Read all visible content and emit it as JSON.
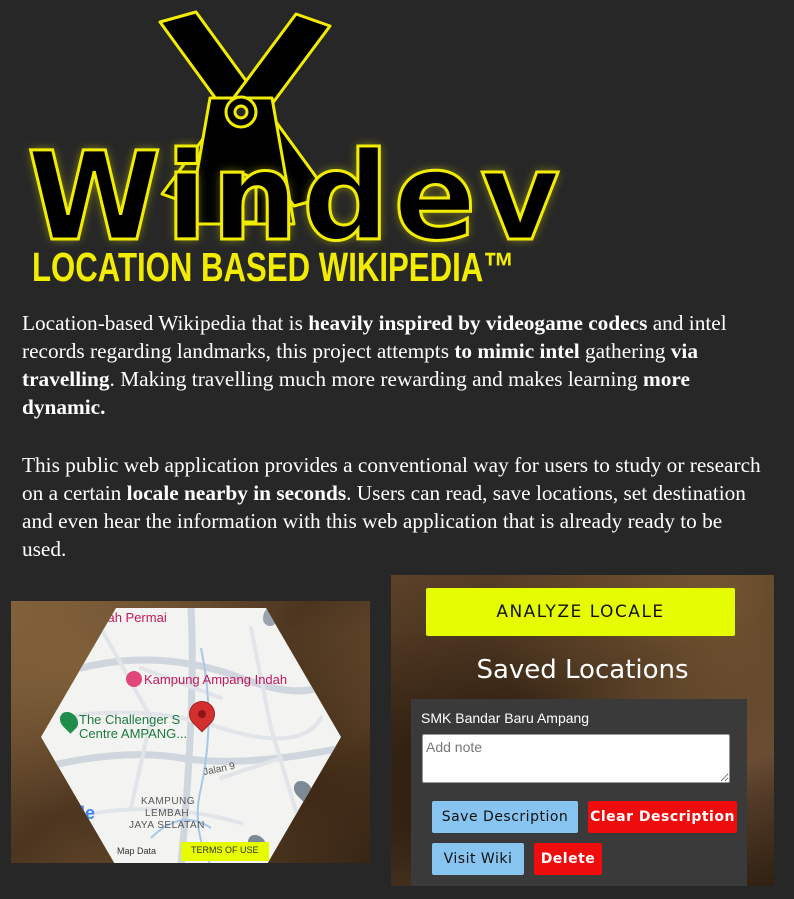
{
  "header": {
    "logo_text": "Windev",
    "tagline": "LOCATION BASED WIKIPEDIA™"
  },
  "description": {
    "p1": [
      {
        "t": "Location-based Wikipedia that is ",
        "b": false
      },
      {
        "t": "heavily inspired by videogame codecs",
        "b": true
      },
      {
        "t": " and intel records regarding landmarks, this project attempts ",
        "b": false
      },
      {
        "t": "to mimic intel",
        "b": true
      },
      {
        "t": " gathering ",
        "b": false
      },
      {
        "t": "via travelling",
        "b": true
      },
      {
        "t": ". Making travelling much more rewarding and makes learning ",
        "b": false
      },
      {
        "t": "more dynamic.",
        "b": true
      }
    ],
    "p2": [
      {
        "t": "This public web application provides a conventional way for users to study or research on a certain ",
        "b": false
      },
      {
        "t": "locale nearby in seconds",
        "b": true
      },
      {
        "t": ". Users can read, save locations, set destination and even hear the information with this web application that is already ready to be used.",
        "b": false
      }
    ]
  },
  "map": {
    "labels": {
      "top_area": "nbah Permai",
      "poi_kampung": "Kampung Ampang Indah",
      "poi_challenger_1": "The Challenger S",
      "poi_challenger_2": "Centre AMPANG...",
      "road": "Jalan 9",
      "area_1": "KAMPUNG",
      "area_2": "LEMBAH",
      "area_3": "JAYA SELATAN",
      "google_partial": "gle",
      "map_data": "Map Data",
      "terms": "TERMS OF USE"
    }
  },
  "locale_panel": {
    "analyze_label": "ANALYZE LOCALE",
    "saved_title": "Saved Locations",
    "saved_items": [
      {
        "name": "SMK Bandar Baru Ampang",
        "note_placeholder": "Add note",
        "note_value": "",
        "save_label": "Save Description",
        "clear_label": "Clear Description",
        "wiki_label": "Visit Wiki",
        "delete_label": "Delete"
      }
    ]
  },
  "colors": {
    "page_bg": "#272727",
    "brand_yellow": "#f1ec00",
    "analyze_button": "#e6fc00",
    "save_button": "#87c4f0",
    "delete_button": "#ee0c0c",
    "map_marker": "#d32f2f"
  },
  "icons": [
    "windmill-icon",
    "map-pin-icon",
    "location-marker-icon",
    "pink-poi-icon",
    "green-poi-icon",
    "grey-poi-icon"
  ]
}
